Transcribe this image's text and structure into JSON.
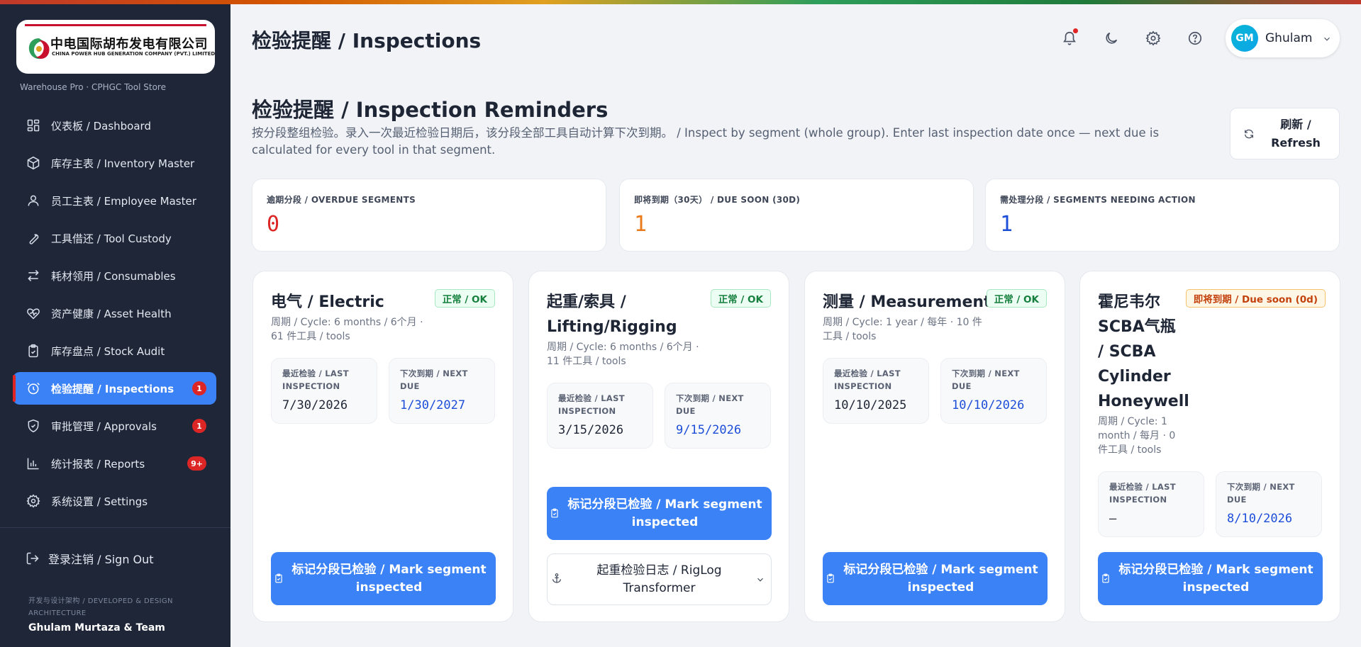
{
  "brand": {
    "logo_cn": "中电国际胡布发电有限公司",
    "logo_en": "CHINA POWER HUB GENERATION COMPANY (PVT.) LIMITED",
    "app_subtitle": "Warehouse Pro · CPHGC Tool Store"
  },
  "sidebar": {
    "items": [
      {
        "label": "仪表板 / Dashboard",
        "icon": "dashboard-icon"
      },
      {
        "label": "库存主表 / Inventory Master",
        "icon": "box-icon"
      },
      {
        "label": "员工主表 / Employee Master",
        "icon": "user-icon"
      },
      {
        "label": "工具借还 / Tool Custody",
        "icon": "wrench-icon"
      },
      {
        "label": "耗材领用 / Consumables",
        "icon": "swap-icon"
      },
      {
        "label": "资产健康 / Asset Health",
        "icon": "heart-pulse-icon"
      },
      {
        "label": "库存盘点 / Stock Audit",
        "icon": "clipboard-check-icon"
      },
      {
        "label": "检验提醒 / Inspections",
        "icon": "alarm-clock-icon",
        "badge": "1",
        "active": true
      },
      {
        "label": "审批管理 / Approvals",
        "icon": "shield-check-icon",
        "badge": "1"
      },
      {
        "label": "统计报表 / Reports",
        "icon": "bar-chart-icon",
        "badge": "9+"
      },
      {
        "label": "系统设置 / Settings",
        "icon": "gear-icon"
      }
    ],
    "sign_out": "登录注销 / Sign Out",
    "dev_label": "开发与设计架构 / DEVELOPED & DESIGN ARCHITECTURE",
    "dev_name": "Ghulam Murtaza & Team"
  },
  "header": {
    "title": "检验提醒 / Inspections",
    "user_initials": "GM",
    "user_name": "Ghulam"
  },
  "section": {
    "title": "检验提醒 / Inspection Reminders",
    "description": "按分段整组检验。录入一次最近检验日期后，该分段全部工具自动计算下次到期。 / Inspect by segment (whole group). Enter last inspection date once — next due is calculated for every tool in that segment.",
    "refresh_label": "刷新 / Refresh"
  },
  "stats": [
    {
      "label": "逾期分段 / OVERDUE SEGMENTS",
      "value": "0",
      "color": "#dc2626"
    },
    {
      "label": "即将到期（30天） / DUE SOON (30D)",
      "value": "1",
      "color": "#ea7a1a"
    },
    {
      "label": "需处理分段 / SEGMENTS NEEDING ACTION",
      "value": "1",
      "color": "#1d4ed8"
    }
  ],
  "labels": {
    "last_inspection": "最近检验 / LAST INSPECTION",
    "next_due": "下次到期 / NEXT DUE",
    "mark_inspected": "标记分段已检验 / Mark segment inspected"
  },
  "segments": [
    {
      "title": "电气 / Electric",
      "status": "正常 / OK",
      "meta": "周期 / Cycle: 6 months / 6个月 · 61 件工具 / tools",
      "last": "7/30/2026",
      "next": "1/30/2027"
    },
    {
      "title": "起重/索具 / Lifting/Rigging",
      "status": "正常 / OK",
      "meta": "周期 / Cycle: 6 months / 6个月 · 11 件工具 / tools",
      "last": "3/15/2026",
      "next": "9/15/2026",
      "riglog": "起重检验日志 / RigLog Transformer"
    },
    {
      "title": "测量 / Measurement",
      "status": "正常 / OK",
      "meta": "周期 / Cycle: 1 year / 每年 · 10 件工具 / tools",
      "last": "10/10/2025",
      "next": "10/10/2026"
    },
    {
      "title": "霍尼韦尔 SCBA气瓶 / SCBA Cylinder Honeywell",
      "status": "即将到期 / Due soon (0d)",
      "meta": "周期 / Cycle: 1 month / 每月 · 0 件工具 / tools",
      "last": "—",
      "next": "8/10/2026"
    }
  ]
}
